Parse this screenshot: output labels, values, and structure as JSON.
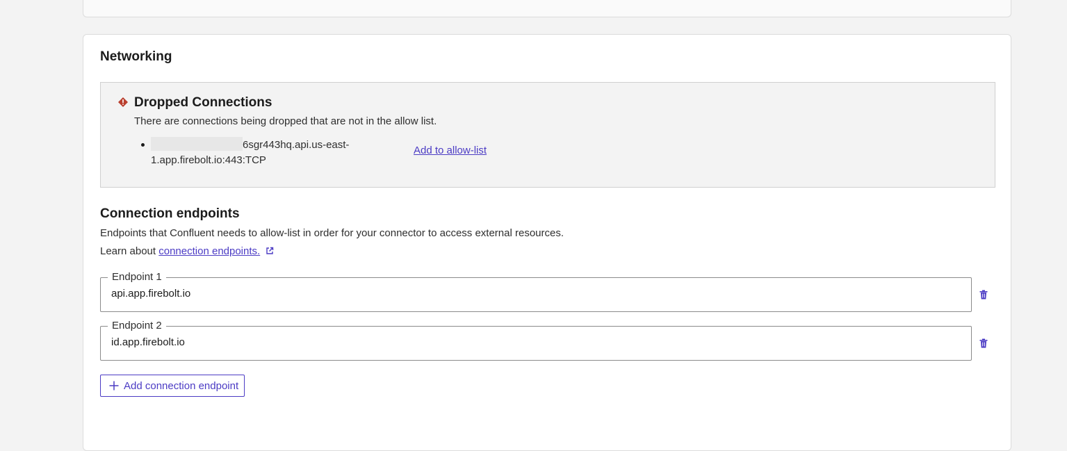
{
  "networking": {
    "title": "Networking",
    "alert": {
      "icon": "diamond-error-icon",
      "color": "#b93f2e",
      "title": "Dropped Connections",
      "description": "There are connections being dropped that are not in the allow list.",
      "items": [
        {
          "host": "6sgr443hq.api.us-east-1.app.firebolt.io:443:TCP",
          "action_label": "Add to allow-list"
        }
      ]
    },
    "endpoints": {
      "title": "Connection endpoints",
      "description": "Endpoints that Confluent needs to allow-list in order for your connector to access external resources.",
      "learn_prefix": "Learn about",
      "learn_link": "connection endpoints.",
      "fields": [
        {
          "label": "Endpoint 1",
          "value": "api.app.firebolt.io"
        },
        {
          "label": "Endpoint 2",
          "value": "id.app.firebolt.io"
        }
      ],
      "add_button_label": "Add connection endpoint"
    },
    "accent_color": "#4b3bc4"
  }
}
